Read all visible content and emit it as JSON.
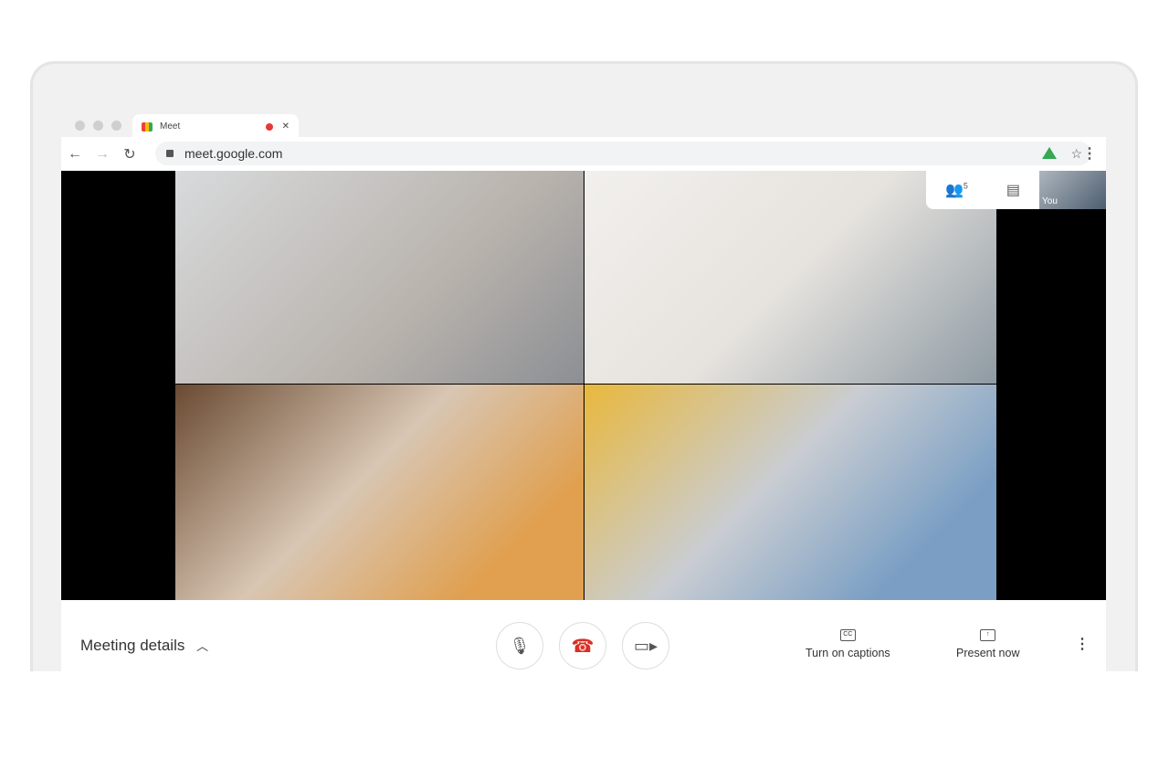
{
  "browser": {
    "tab_title": "Meet",
    "url": "meet.google.com"
  },
  "meeting": {
    "participant_count": "5",
    "self_label": "You",
    "details_label": "Meeting details",
    "captions_label": "Turn on captions",
    "present_label": "Present now"
  },
  "colors": {
    "end_call": "#d93025",
    "recording": "#e53935"
  }
}
